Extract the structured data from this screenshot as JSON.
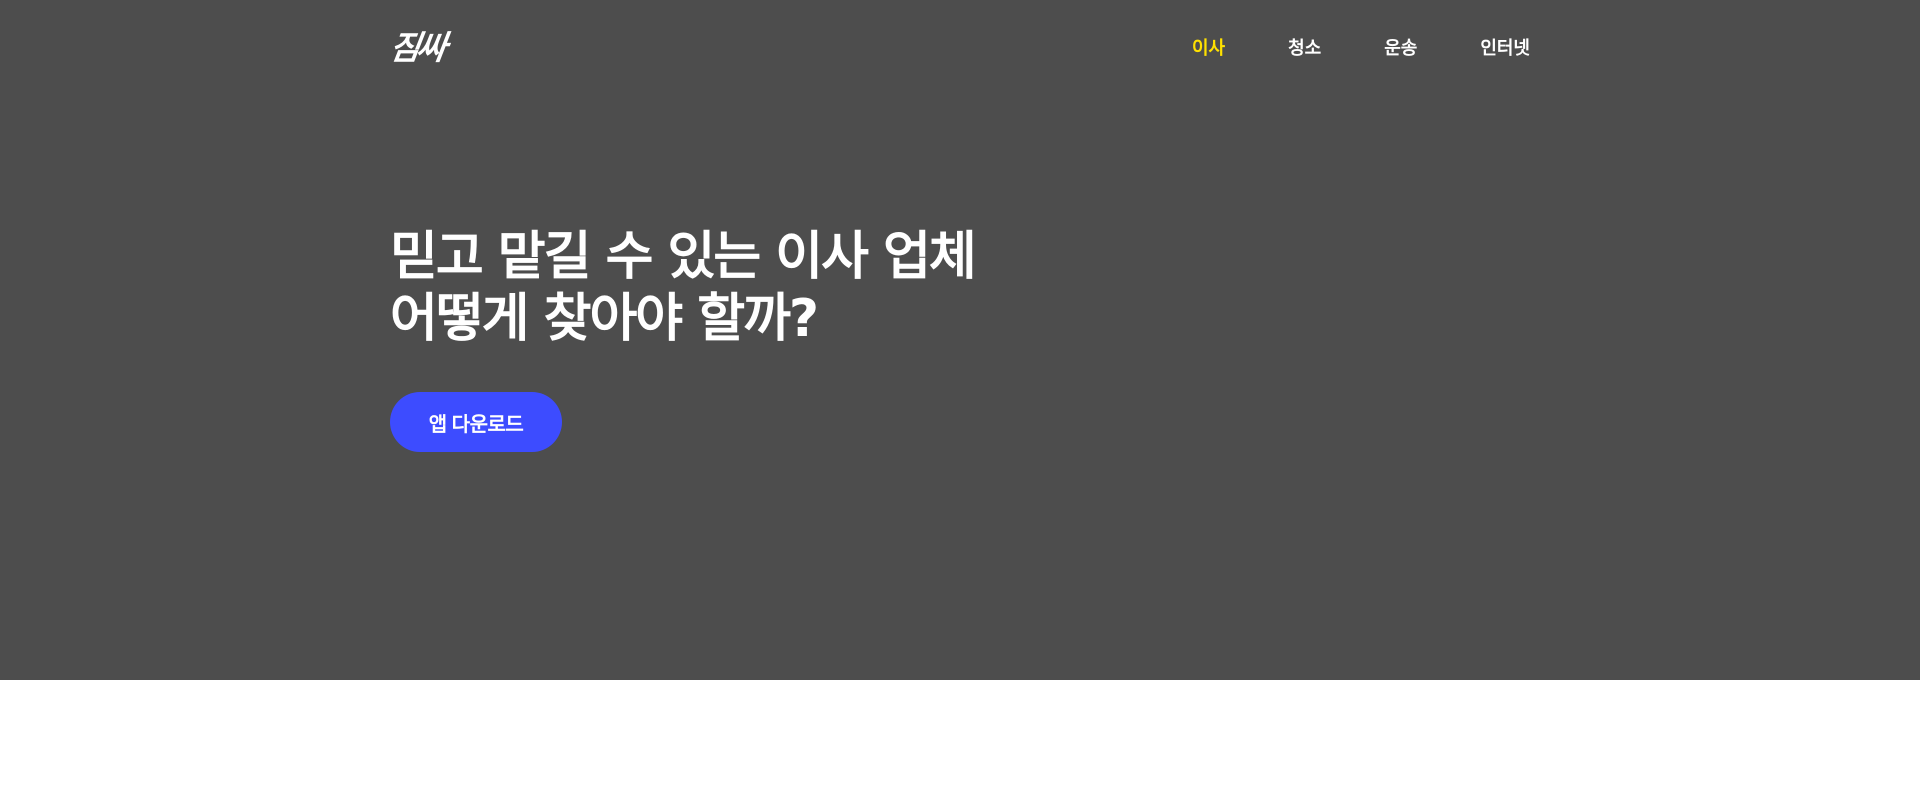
{
  "header": {
    "logo_text": "짐싸",
    "nav": [
      {
        "label": "이사",
        "active": true
      },
      {
        "label": "청소",
        "active": false
      },
      {
        "label": "운송",
        "active": false
      },
      {
        "label": "인터넷",
        "active": false
      }
    ]
  },
  "hero": {
    "headline_line1": "믿고 맡길 수 있는 이사 업체",
    "headline_line2": "어떻게 찾아야 할까?",
    "cta_label": "앱 다운로드"
  },
  "colors": {
    "hero_background": "#4d4d4d",
    "nav_active": "#ffe100",
    "cta_background": "#3d4cff",
    "text": "#ffffff"
  }
}
